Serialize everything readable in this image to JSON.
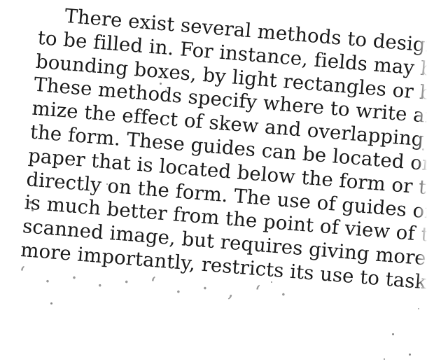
{
  "document": {
    "lines": [
      "There exist several methods to design",
      "to be filled in. For instance, fields may b",
      "bounding boxes, by light rectangles or b",
      "These methods specify where to write and",
      "mize the effect of skew and overlapping w",
      "the form. These guides can be located on a",
      "paper that is located below the form or th",
      "directly on the form. The use of guides on",
      "is much better from the point of view of t",
      "scanned image, but requires giving more",
      "more importantly, restricts its use to task"
    ]
  }
}
